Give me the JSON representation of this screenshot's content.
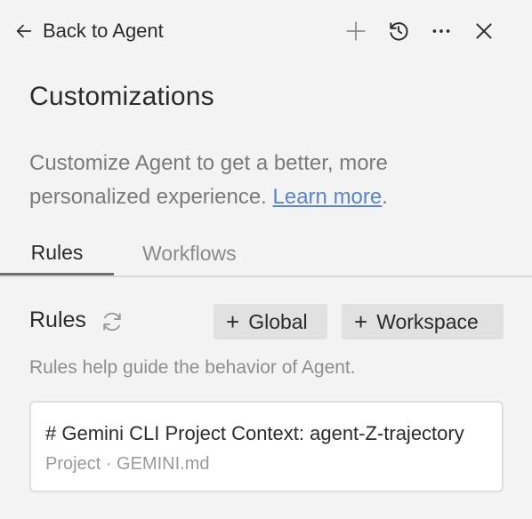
{
  "header": {
    "back_label": "Back to Agent",
    "icons": [
      "arrow-left-icon",
      "plus-icon",
      "history-icon",
      "more-icon",
      "close-icon"
    ]
  },
  "page": {
    "title": "Customizations",
    "description": "Customize Agent to get a better, more personalized experience. ",
    "learn_more": "Learn more",
    "description_end": "."
  },
  "tabs": [
    {
      "label": "Rules",
      "active": true
    },
    {
      "label": "Workflows",
      "active": false
    }
  ],
  "rules": {
    "heading": "Rules",
    "global_label": "Global",
    "workspace_label": "Workspace",
    "plus": "+",
    "helper": "Rules help guide the behavior of Agent.",
    "items": [
      {
        "title": "# Gemini CLI Project Context: agent-Z-trajectory",
        "subtitle": "Project · GEMINI.md"
      }
    ]
  },
  "colors": {
    "background": "#f3f3f3",
    "link": "#5b86c6",
    "pill": "#e1e1e1"
  }
}
